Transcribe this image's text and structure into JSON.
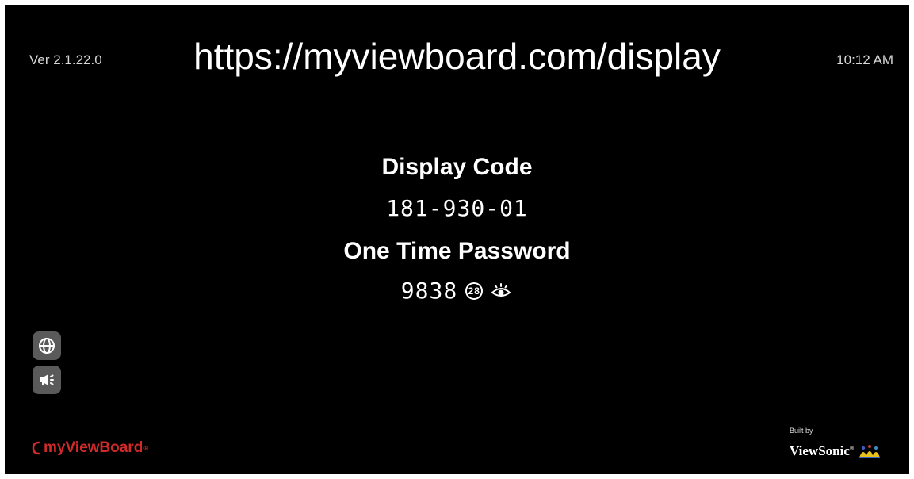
{
  "header": {
    "version": "Ver 2.1.22.0",
    "url": "https://myviewboard.com/display",
    "time": "10:12 AM"
  },
  "display_code": {
    "label": "Display Code",
    "value": "181-930-01"
  },
  "otp": {
    "label": "One Time Password",
    "value": "9838",
    "timer": "28"
  },
  "side_buttons": {
    "language_icon": "globe-icon",
    "announce_icon": "megaphone-icon"
  },
  "footer": {
    "brand": "myViewBoard",
    "brand_reg": "®",
    "built_by": "Built by",
    "maker": "ViewSonic",
    "maker_reg": "®"
  },
  "colors": {
    "background": "#000000",
    "text": "#ffffff",
    "button": "#5a5a5a",
    "brand_red": "#d12a2a"
  }
}
